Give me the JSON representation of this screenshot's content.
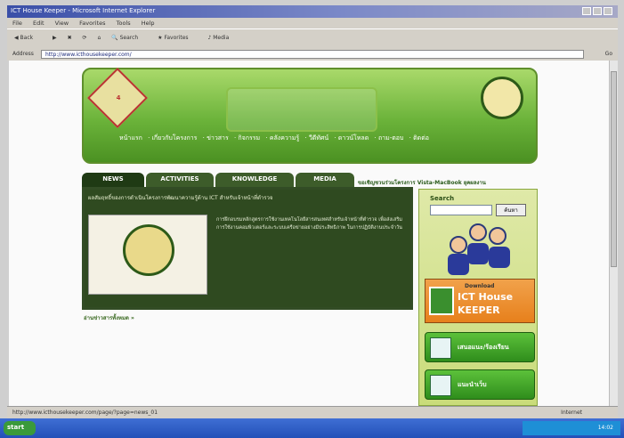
{
  "window": {
    "title": "ICT House Keeper - Microsoft Internet Explorer"
  },
  "menu": [
    "File",
    "Edit",
    "View",
    "Favorites",
    "Tools",
    "Help"
  ],
  "toolbar": {
    "back": "Back",
    "search": "Search",
    "favorites": "Favorites",
    "media": "Media"
  },
  "address": {
    "label": "Address",
    "url": "http://www.icthousekeeper.com/",
    "go": "Go"
  },
  "banner": {
    "logo_text": "4"
  },
  "nav": {
    "items": [
      "หน้าแรก",
      "เกี่ยวกับโครงการ",
      "ข่าวสาร",
      "กิจกรรม",
      "คลังความรู้",
      "วีดีทัศน์",
      "ดาวน์โหลด",
      "ถาม-ตอบ",
      "ติดต่อ"
    ]
  },
  "tabs": [
    "NEWS",
    "ACTIVITIES",
    "KNOWLEDGE",
    "MEDIA"
  ],
  "ticker": "ขอเชิญชวนร่วมโครงการ Vista-MacBook ยุคผลงาน",
  "news": {
    "headline": "ผลสัมฤทธิ์ของการดำเนินโครงการพัฒนาความรู้ด้าน ICT สำหรับเจ้าหน้าที่ตำรวจ",
    "body": "การฝึกอบรมหลักสูตรการใช้งานเทคโนโลยีสารสนเทศสำหรับเจ้าหน้าที่ตำรวจ เพื่อส่งเสริมการใช้งานคอมพิวเตอร์และระบบเครือข่ายอย่างมีประสิทธิภาพ ในการปฏิบัติงานประจำวัน",
    "more": "อ่านข่าวสารทั้งหมด »"
  },
  "sidebar": {
    "search_label": "Search",
    "search_placeholder": "",
    "search_button": "ค้นหา",
    "ict_download": "Download",
    "ict_title_line1": "ICT House",
    "ict_title_line2": "KEEPER",
    "buttons": [
      "เสนอแนะ/ร้องเรียน",
      "แนะนำเว็บ"
    ]
  },
  "status": {
    "text": "http://www.icthousekeeper.com/page/?page=news_01",
    "zone": "Internet"
  },
  "taskbar": {
    "start": "start",
    "clock": "14:02"
  },
  "colors": {
    "brand_green": "#6bb33a",
    "panel_dark": "#2f4a20",
    "orange": "#e7801c"
  }
}
